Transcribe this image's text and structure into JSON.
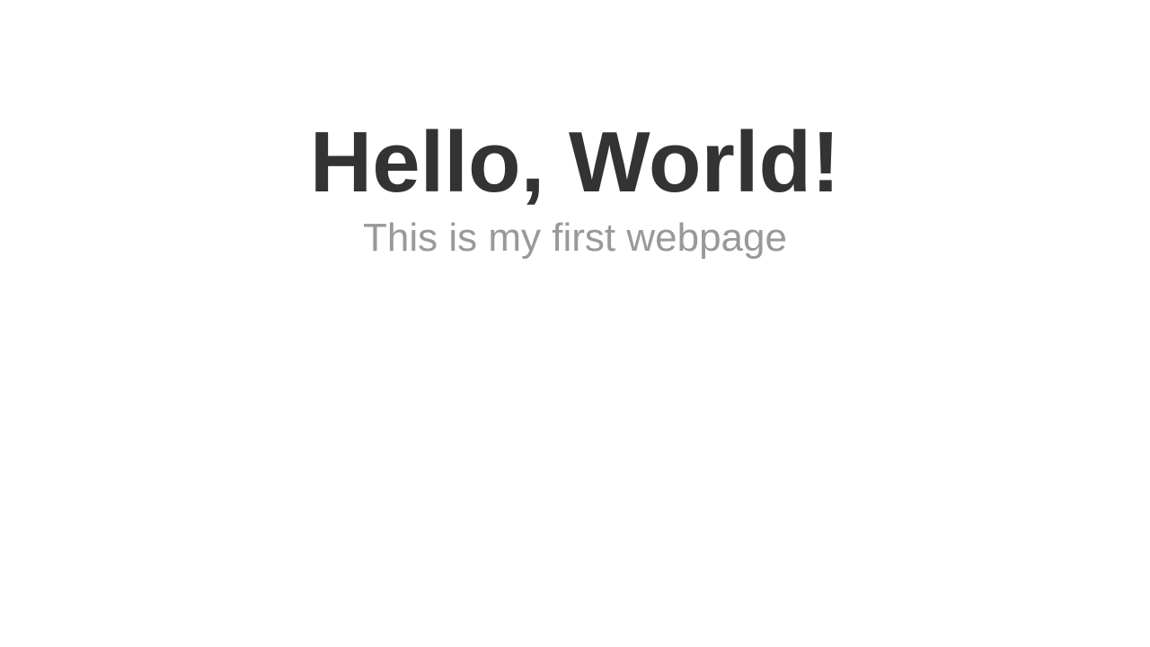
{
  "page": {
    "heading": "Hello, World!",
    "subtitle": "This is my first webpage"
  },
  "colors": {
    "background": "#ffffff",
    "heading": "#333333",
    "subtitle": "#999999"
  }
}
